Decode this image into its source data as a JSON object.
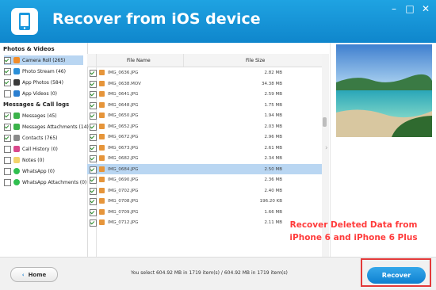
{
  "window": {
    "title": "Recover from iOS device",
    "buttons": {
      "minimize": "–",
      "maximize": "□",
      "close": "✕"
    }
  },
  "sidebar": {
    "categories": [
      {
        "title": "Photos & Videos",
        "items": [
          {
            "label": "Camera Roll (265)",
            "checked": true,
            "selected": true,
            "icon": "camera-roll-icon",
            "color": "#f08c2a"
          },
          {
            "label": "Photo Stream (46)",
            "checked": true,
            "icon": "photo-stream-icon",
            "color": "#2a8fd8"
          },
          {
            "label": "App Photos (584)",
            "checked": true,
            "icon": "app-photos-icon",
            "color": "#3a3a3a"
          },
          {
            "label": "App Videos (0)",
            "checked": false,
            "icon": "app-videos-icon",
            "color": "#2b7fd1"
          }
        ]
      },
      {
        "title": "Messages & Call logs",
        "items": [
          {
            "label": "Messages (45)",
            "checked": true,
            "icon": "messages-icon",
            "color": "#3bb34a"
          },
          {
            "label": "Messages Attachments (14)",
            "checked": true,
            "icon": "attachments-icon",
            "color": "#3bb34a"
          },
          {
            "label": "Contacts (765)",
            "checked": true,
            "icon": "contacts-icon",
            "color": "#8b8b8b"
          },
          {
            "label": "Call History (0)",
            "checked": false,
            "icon": "call-history-icon",
            "color": "#d94a8c"
          },
          {
            "label": "Notes (0)",
            "checked": false,
            "icon": "notes-icon",
            "color": "#f2d36b"
          },
          {
            "label": "WhatsApp (0)",
            "checked": false,
            "icon": "whatsapp-icon",
            "color": "#2fbf4f"
          },
          {
            "label": "WhatsApp Attachments (0)",
            "checked": false,
            "icon": "whatsapp-attachments-icon",
            "color": "#2fbf4f"
          }
        ]
      }
    ]
  },
  "table": {
    "columns": [
      "File Name",
      "File Size"
    ],
    "rows": [
      {
        "name": "IMG_0636.JPG",
        "size": "2.82 MB",
        "checked": true
      },
      {
        "name": "IMG_0638.MOV",
        "size": "34.38 MB",
        "checked": true
      },
      {
        "name": "IMG_0641.JPG",
        "size": "2.59 MB",
        "checked": true
      },
      {
        "name": "IMG_0648.JPG",
        "size": "1.75 MB",
        "checked": true
      },
      {
        "name": "IMG_0650.JPG",
        "size": "1.94 MB",
        "checked": true
      },
      {
        "name": "IMG_0652.JPG",
        "size": "2.03 MB",
        "checked": true
      },
      {
        "name": "IMG_0672.JPG",
        "size": "2.96 MB",
        "checked": true
      },
      {
        "name": "IMG_0673.JPG",
        "size": "2.61 MB",
        "checked": true
      },
      {
        "name": "IMG_0682.JPG",
        "size": "2.34 MB",
        "checked": true
      },
      {
        "name": "IMG_0684.JPG",
        "size": "2.50 MB",
        "checked": true,
        "selected": true
      },
      {
        "name": "IMG_0690.JPG",
        "size": "2.36 MB",
        "checked": true
      },
      {
        "name": "IMG_0702.JPG",
        "size": "2.40 MB",
        "checked": true
      },
      {
        "name": "IMG_0708.JPG",
        "size": "196.20 KB",
        "checked": true
      },
      {
        "name": "IMG_0709.JPG",
        "size": "1.66 MB",
        "checked": true
      },
      {
        "name": "IMG_0712.JPG",
        "size": "2.11 MB",
        "checked": true
      }
    ]
  },
  "footer": {
    "home_label": "Home",
    "summary": "You select 604.92 MB in 1719 item(s) / 604.92 MB in 1719 item(s)",
    "recover_label": "Recover"
  },
  "overlay": {
    "line1": "Recover Deleted Data from",
    "line2": "iPhone 6 and  iPhone 6 Plus"
  }
}
